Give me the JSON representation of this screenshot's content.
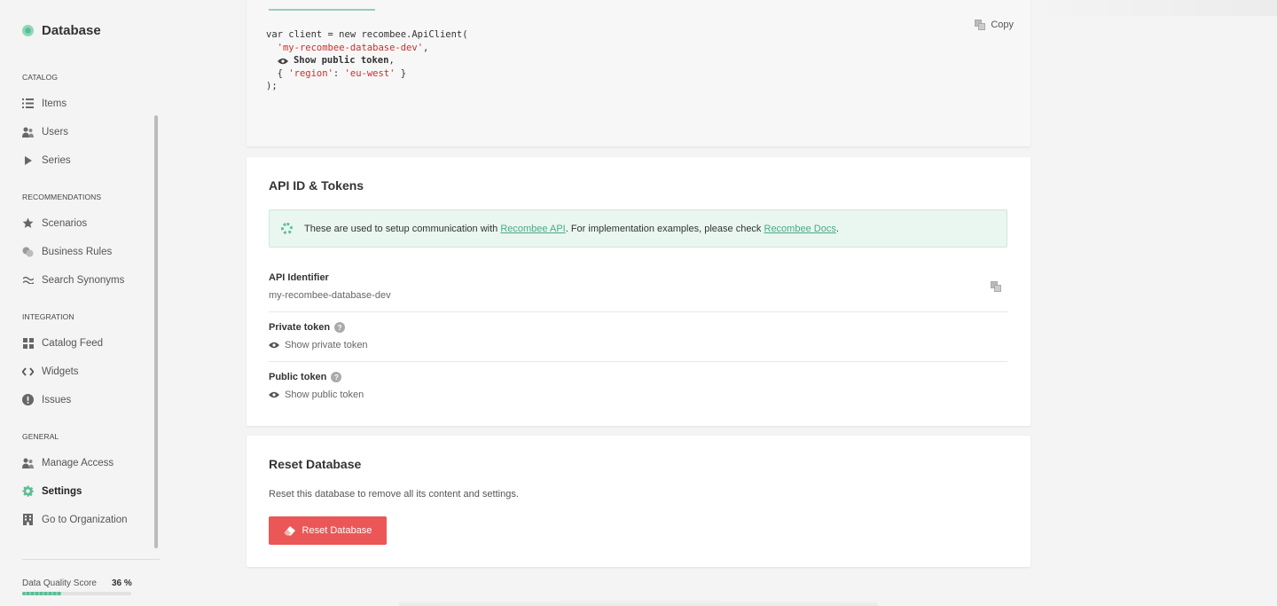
{
  "sidebar": {
    "title": "Database",
    "sections": {
      "catalog": "CATALOG",
      "recommendations": "RECOMMENDATIONS",
      "integration": "INTEGRATION",
      "general": "GENERAL"
    },
    "items": {
      "items": "Items",
      "users": "Users",
      "series": "Series",
      "scenarios": "Scenarios",
      "business_rules": "Business Rules",
      "search_synonyms": "Search Synonyms",
      "catalog_feed": "Catalog Feed",
      "widgets": "Widgets",
      "issues": "Issues",
      "manage_access": "Manage Access",
      "settings": "Settings",
      "go_to_org": "Go to Organization"
    },
    "data_quality": {
      "label": "Data Quality Score",
      "value": "36 %",
      "fraction": 0.36
    }
  },
  "code": {
    "line1": "var client = new recombee.ApiClient(",
    "db": "'my-recombee-database-dev'",
    "comma": ",",
    "show_token": "Show public token",
    "region_open": "{ ",
    "region_key": "'region'",
    "region_colon": ": ",
    "region_val": "'eu-west'",
    "region_close": " }",
    "close": ");",
    "copy_label": "Copy"
  },
  "tokens": {
    "title": "API ID & Tokens",
    "info_prefix": "These are used to setup communication with ",
    "info_link1": "Recombee API",
    "info_middle": ". For implementation examples, please check ",
    "info_link2": "Recombee Docs",
    "info_suffix": ".",
    "api_id_label": "API Identifier",
    "api_id_value": "my-recombee-database-dev",
    "private_label": "Private token",
    "private_show": "Show private token",
    "public_label": "Public token",
    "public_show": "Show public token",
    "help": "?"
  },
  "reset": {
    "title": "Reset Database",
    "text": "Reset this database to remove all its content and settings.",
    "button": "Reset Database"
  },
  "colors": {
    "accent": "#5bbd96",
    "danger": "#eb5757"
  }
}
